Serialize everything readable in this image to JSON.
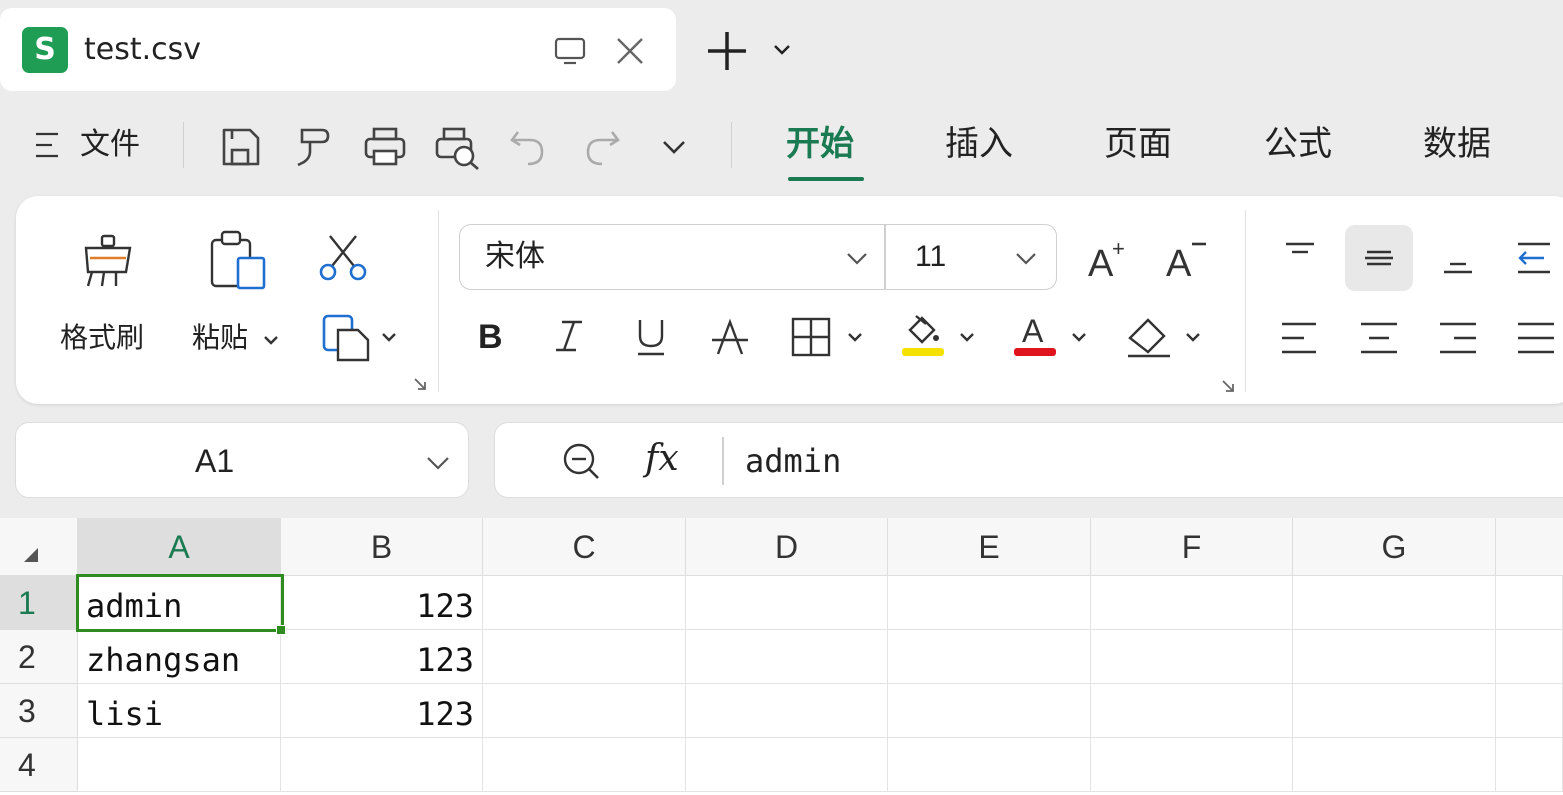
{
  "tab": {
    "app_letter": "S",
    "title": "test.csv"
  },
  "menu": {
    "file_label": "文件",
    "ribbon_tabs": [
      {
        "label": "开始",
        "active": true
      },
      {
        "label": "插入"
      },
      {
        "label": "页面"
      },
      {
        "label": "公式"
      },
      {
        "label": "数据"
      }
    ]
  },
  "ribbon": {
    "format_painter_label": "格式刷",
    "paste_label": "粘贴",
    "font_name": "宋体",
    "font_size": "11",
    "highlight_color": "#f5e100",
    "font_color": "#e0141e",
    "increase_font_icon": "A+",
    "decrease_font_icon": "A−"
  },
  "formula": {
    "cell_ref": "A1",
    "fx_label": "fx",
    "content": "admin"
  },
  "sheet": {
    "columns": [
      "A",
      "B",
      "C",
      "D",
      "E",
      "F",
      "G"
    ],
    "rows": [
      "1",
      "2",
      "3",
      "4"
    ],
    "cells": [
      [
        "admin",
        "123"
      ],
      [
        "zhangsan",
        "123"
      ],
      [
        "lisi",
        "123"
      ],
      [
        "",
        ""
      ]
    ],
    "active_cell": "A1",
    "accent_color": "#1a7a52"
  }
}
